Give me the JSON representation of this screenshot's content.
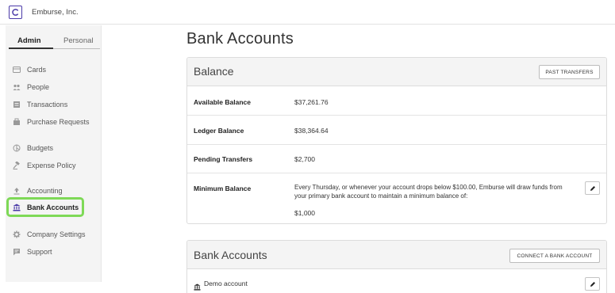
{
  "header": {
    "company_name": "Emburse, Inc.",
    "logo_icon": "emburse-logo-icon",
    "brand_color": "#4b3aa8"
  },
  "sidebar": {
    "tabs": [
      {
        "label": "Admin",
        "active": true
      },
      {
        "label": "Personal",
        "active": false
      }
    ],
    "items": [
      {
        "label": "Cards",
        "icon": "card-icon"
      },
      {
        "label": "People",
        "icon": "people-icon"
      },
      {
        "label": "Transactions",
        "icon": "list-icon"
      },
      {
        "label": "Purchase Requests",
        "icon": "cart-icon"
      },
      {
        "label": "Budgets",
        "icon": "pie-icon"
      },
      {
        "label": "Expense Policy",
        "icon": "gavel-icon"
      },
      {
        "label": "Accounting",
        "icon": "upload-icon"
      },
      {
        "label": "Bank Accounts",
        "icon": "bank-icon",
        "active": true
      },
      {
        "label": "Company Settings",
        "icon": "gear-icon"
      },
      {
        "label": "Support",
        "icon": "chat-icon"
      }
    ],
    "highlight_color": "#7ed957"
  },
  "main": {
    "page_title": "Bank Accounts",
    "balance": {
      "title": "Balance",
      "past_transfers_label": "PAST TRANSFERS",
      "rows": [
        {
          "label": "Available Balance",
          "value": "$37,261.76"
        },
        {
          "label": "Ledger Balance",
          "value": "$38,364.64"
        },
        {
          "label": "Pending Transfers",
          "value": "$2,700"
        }
      ],
      "minimum": {
        "label": "Minimum Balance",
        "description": "Every Thursday, or whenever your account drops below $100.00, Emburse will draw funds from your primary bank account to maintain a minimum balance of:",
        "value": "$1,000",
        "edit_icon": "pencil-icon"
      }
    },
    "bank_accounts": {
      "title": "Bank Accounts",
      "connect_label": "CONNECT A BANK ACCOUNT",
      "accounts": [
        {
          "name": "Demo account",
          "icon": "bank-icon",
          "edit_icon": "pencil-icon"
        }
      ]
    }
  }
}
